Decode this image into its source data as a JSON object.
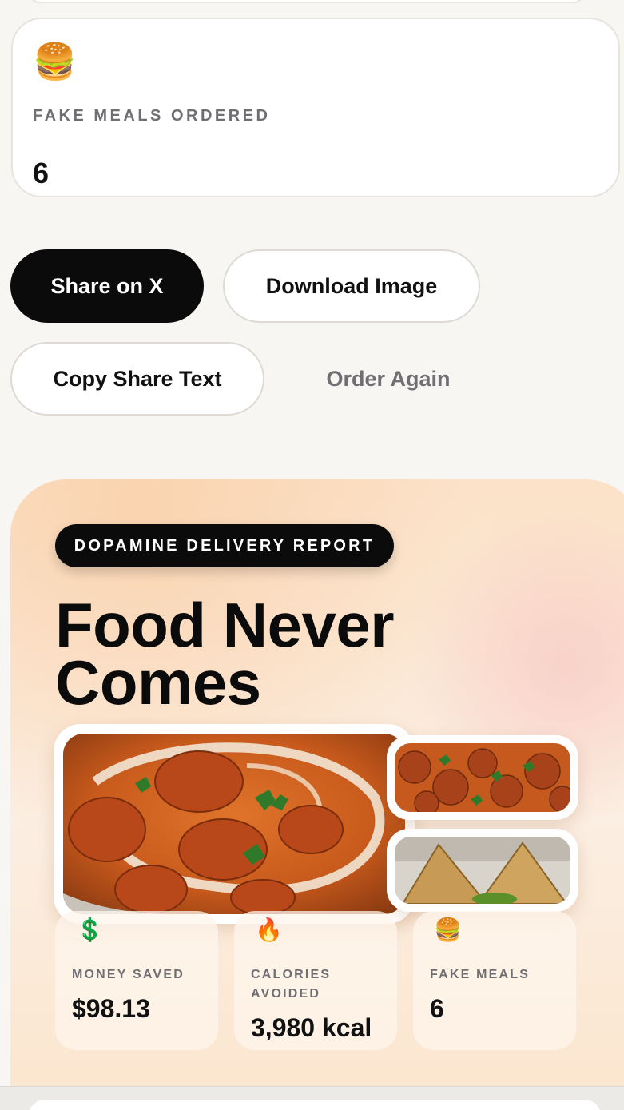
{
  "stat_card": {
    "emoji": "🍔",
    "label": "FAKE MEALS ORDERED",
    "value": "6"
  },
  "actions": {
    "share_x": "Share on X",
    "download": "Download Image",
    "copy": "Copy Share Text",
    "order_again": "Order Again"
  },
  "report": {
    "badge": "DOPAMINE DELIVERY REPORT",
    "headline": "Food Never Comes",
    "photos": [
      "butter-chicken-curry",
      "meatball-curry",
      "samosas-with-chutney"
    ],
    "stats": [
      {
        "emoji": "💲",
        "label": "MONEY SAVED",
        "value": "$98.13"
      },
      {
        "emoji": "🔥",
        "label": "CALORIES AVOIDED",
        "value": "3,980 kcal"
      },
      {
        "emoji": "🍔",
        "label": "FAKE MEALS",
        "value": "6"
      }
    ]
  }
}
